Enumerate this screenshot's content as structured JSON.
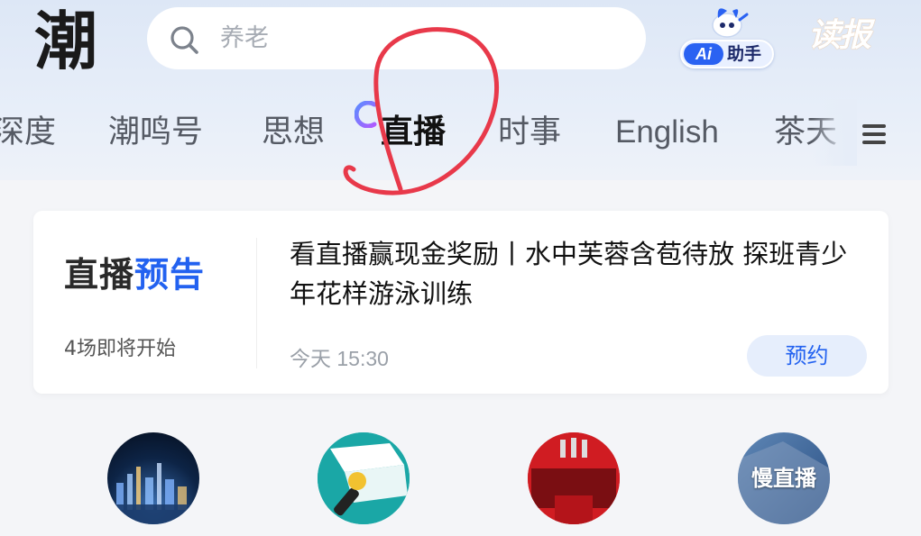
{
  "header": {
    "logo_text": "潮",
    "search": {
      "placeholder": "养老"
    },
    "ai_helper": {
      "badge": "Ai",
      "label": "助手"
    },
    "read_paper_label": "读报"
  },
  "channels_nav": {
    "tabs": [
      {
        "label": "深度"
      },
      {
        "label": "潮鸣号"
      },
      {
        "label": "思想"
      },
      {
        "label": "直播",
        "active": true
      },
      {
        "label": "时事"
      },
      {
        "label": "English"
      },
      {
        "label": "茶天"
      }
    ]
  },
  "live_preview": {
    "title_part1": "直播",
    "title_part2": "预告",
    "count_text": "4场即将开始",
    "headline": "看直播赢现金奖励丨水中芙蓉含苞待放 探班青少年花样游泳训练",
    "time": "今天 15:30",
    "reserve_label": "预约"
  },
  "live_channels": [
    {
      "icon": "city-night-thumbnail"
    },
    {
      "icon": "microphone-thumbnail"
    },
    {
      "icon": "press-conference-podium-thumbnail"
    },
    {
      "icon": "slow-live-thumbnail",
      "label": "慢直播"
    }
  ],
  "colors": {
    "accent": "#2362f0",
    "annotation": "#e8394a",
    "header_bg": "#dde7f6"
  }
}
